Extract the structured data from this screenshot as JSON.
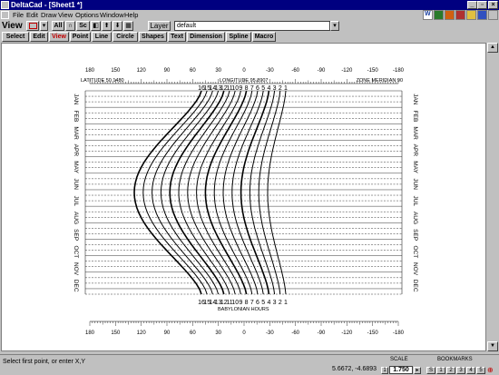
{
  "window": {
    "title": "DeltaCad - [Sheet1 *]"
  },
  "menubar": {
    "items": [
      "File",
      "Edit",
      "Draw",
      "View",
      "Options",
      "Window",
      "Help"
    ]
  },
  "toolbar": {
    "mode_label": "View",
    "all_label": "All",
    "sc_label": "Sc",
    "layer_button": "Layer",
    "layer_value": "default"
  },
  "tabs": [
    "Select",
    "Edit",
    "View",
    "Point",
    "Line",
    "Circle",
    "Shapes",
    "Text",
    "Dimension",
    "Spline",
    "Macro"
  ],
  "active_tab": "View",
  "drawing": {
    "latitude": "LATITUDE 50.1480",
    "longitude": "LONGITUDE 95.8907",
    "zone_meridian": "ZONE MERIDIAN 90",
    "babylonian_hours": "BABYLONIAN HOURS",
    "scale_top": [
      "180",
      "150",
      "120",
      "90",
      "60",
      "30",
      "0",
      "-30",
      "-60",
      "-90",
      "-120",
      "-150",
      "-180"
    ],
    "scale_bottom": [
      "180",
      "150",
      "120",
      "90",
      "60",
      "30",
      "0",
      "-30",
      "-60",
      "-90",
      "-120",
      "-150",
      "-180"
    ],
    "hour_labels_top": [
      "16",
      "15",
      "14",
      "13",
      "12",
      "11",
      "10",
      "9",
      "8",
      "7",
      "6",
      "5",
      "4",
      "3",
      "2",
      "1"
    ],
    "hour_labels_bottom": [
      "16",
      "15",
      "14",
      "13",
      "12",
      "11",
      "10",
      "9",
      "8",
      "7",
      "6",
      "5",
      "4",
      "3",
      "2",
      "1"
    ],
    "months": [
      "JAN",
      "FEB",
      "MAR",
      "APR",
      "MAY",
      "JUN",
      "JUL",
      "AUG",
      "SEP",
      "OCT",
      "NOV",
      "DEC"
    ]
  },
  "status": {
    "prompt": "Select first point, or enter X,Y",
    "coords": "5.6672, -4.6893",
    "scale_label": "SCALE",
    "scale_value": "1.750",
    "bookmarks_label": "BOOKMARKS",
    "bookmarks": [
      "S",
      "1",
      "2",
      "3",
      "4",
      "5"
    ]
  },
  "colors": {
    "title_bg": "#000080",
    "active_tab": "#c00000"
  }
}
